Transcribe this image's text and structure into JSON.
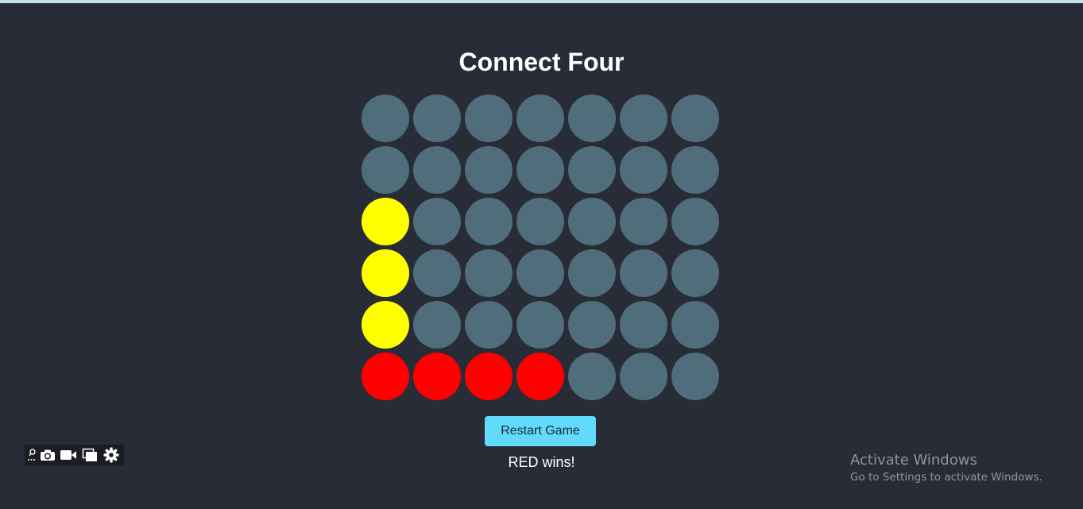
{
  "title": "Connect Four",
  "board": {
    "rows": 6,
    "cols": 7,
    "cells": [
      [
        "empty",
        "empty",
        "empty",
        "empty",
        "empty",
        "empty",
        "empty"
      ],
      [
        "empty",
        "empty",
        "empty",
        "empty",
        "empty",
        "empty",
        "empty"
      ],
      [
        "yellow",
        "empty",
        "empty",
        "empty",
        "empty",
        "empty",
        "empty"
      ],
      [
        "yellow",
        "empty",
        "empty",
        "empty",
        "empty",
        "empty",
        "empty"
      ],
      [
        "yellow",
        "empty",
        "empty",
        "empty",
        "empty",
        "empty",
        "empty"
      ],
      [
        "red",
        "red",
        "red",
        "red",
        "empty",
        "empty",
        "empty"
      ]
    ]
  },
  "colors": {
    "empty": "#4f6d7a",
    "red": "#ff0000",
    "yellow": "#ffff00",
    "background": "#282c36",
    "button": "#61dafb"
  },
  "restart_label": "Restart Game",
  "status": "RED wins!",
  "toolbar": {
    "icons": [
      "pin-icon",
      "camera-icon",
      "video-icon",
      "copy-windows-icon",
      "gear-icon"
    ]
  },
  "watermark": {
    "title": "Activate Windows",
    "subtitle": "Go to Settings to activate Windows."
  }
}
